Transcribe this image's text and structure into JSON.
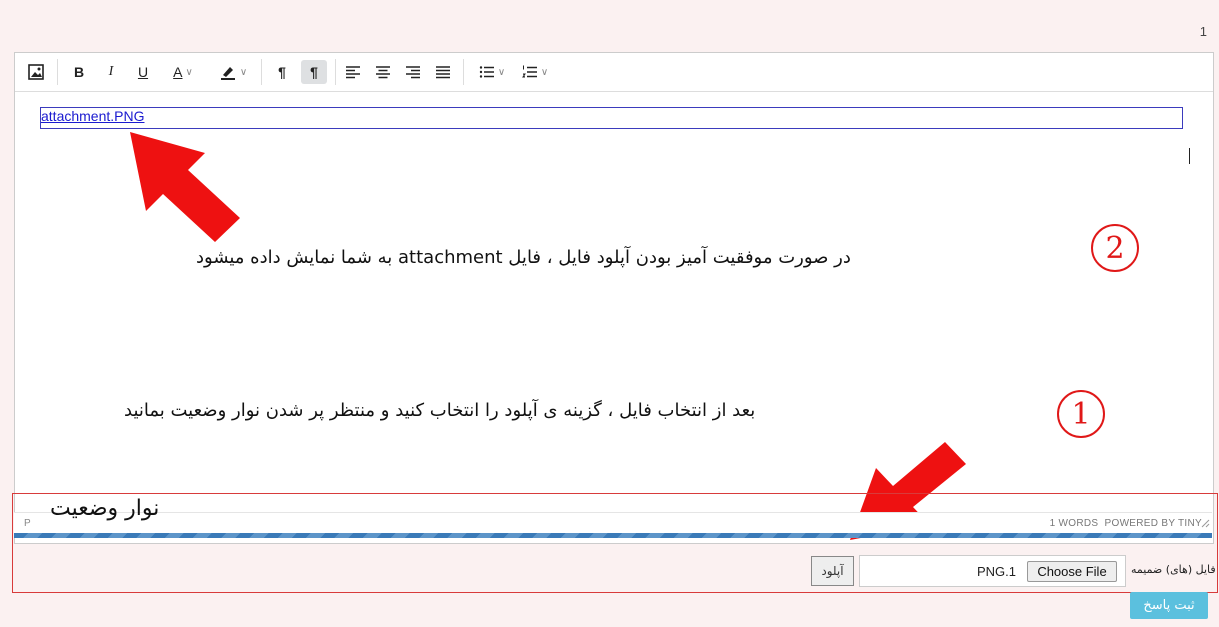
{
  "page": {
    "number": "1"
  },
  "toolbar": {
    "bold_label": "B",
    "italic_label": "I",
    "underline_label": "U",
    "text_color_label": "A",
    "ltr_label": "¶",
    "rtl_label": "¶"
  },
  "editor": {
    "link_text": "attachment.PNG",
    "annotation_2": "در صورت موفقیت آمیز بودن آپلود فایل ، فایل attachment به شما نمایش داده میشود",
    "annotation_1": "بعد از انتخاب فایل ، گزینه ی آپلود را انتخاب کنید و منتظر پر شدن نوار وضعیت بمانید",
    "marker_2": "2",
    "marker_1": "1"
  },
  "statusbar": {
    "path": "P",
    "words": "1 WORDS",
    "powered": "POWERED BY TINY",
    "status_label": "نوار وضعیت"
  },
  "upload": {
    "progress": 1.0,
    "upload_button": "آپلود",
    "file_name": "PNG.1",
    "choose_button": "Choose File",
    "attachments_label": "فایل (های) ضمیمه"
  },
  "submit_label": "ثبت پاسخ",
  "colors": {
    "annotation_red": "#e01818",
    "link_blue": "#1a1ad0",
    "submit_bg": "#5bc0de",
    "progress_blue": "#3a7ab8"
  }
}
